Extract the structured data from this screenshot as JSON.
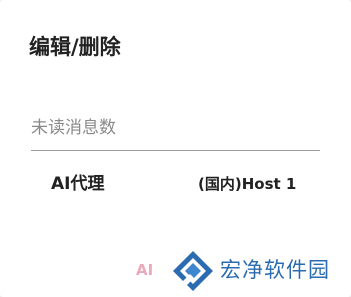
{
  "dialog": {
    "title": "编辑/删除",
    "field": {
      "placeholder": "未读消息数",
      "value": ""
    },
    "row": {
      "label": "AI代理",
      "value": "(国内)Host 1"
    },
    "action_button": "AI"
  },
  "watermark": {
    "text": "宏净软件园",
    "logo_icon": "wk-logo-icon"
  },
  "colors": {
    "text": "#222222",
    "placeholder": "#8a8a8a",
    "underline": "#9e9e9e",
    "action": "#e9a0b4",
    "watermark": "#2b6cb0"
  }
}
